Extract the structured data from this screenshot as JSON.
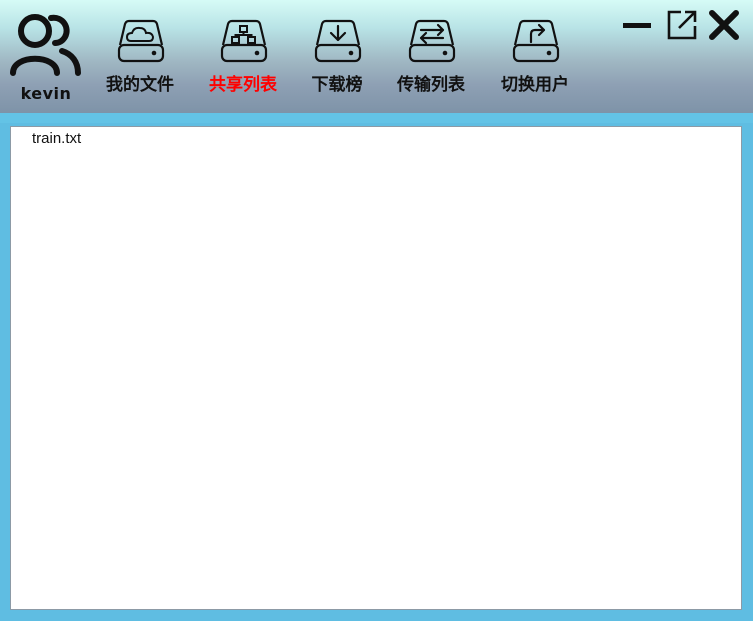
{
  "user": {
    "name": "kevin",
    "icon": "users-icon"
  },
  "nav": {
    "items": [
      {
        "label": "我的文件",
        "icon": "cloud-drive-icon",
        "active": false
      },
      {
        "label": "共享列表",
        "icon": "share-drive-icon",
        "active": true
      },
      {
        "label": "下载榜",
        "icon": "download-drive-icon",
        "active": false
      },
      {
        "label": "传输列表",
        "icon": "transfer-drive-icon",
        "active": false
      },
      {
        "label": "切换用户",
        "icon": "switch-user-drive-icon",
        "active": false
      }
    ],
    "active_color": "#ff0000"
  },
  "window_controls": {
    "minimize": "minimize-icon",
    "popout": "external-window-icon",
    "close": "close-icon"
  },
  "files": [
    {
      "name": "train.txt"
    }
  ]
}
